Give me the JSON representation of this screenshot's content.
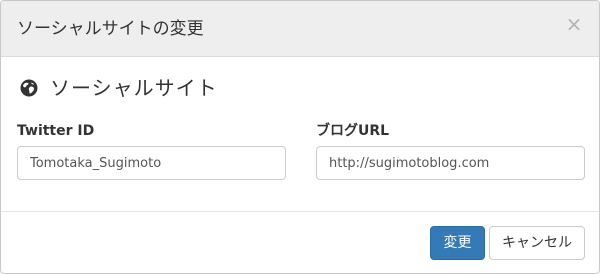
{
  "dialog": {
    "title": "ソーシャルサイトの変更",
    "close_symbol": "×"
  },
  "section": {
    "icon": "globe-icon",
    "title": "ソーシャルサイト"
  },
  "fields": {
    "twitter": {
      "label": "Twitter ID",
      "value": "Tomotaka_Sugimoto"
    },
    "blog": {
      "label": "ブログURL",
      "value": "http://sugimotoblog.com"
    }
  },
  "footer": {
    "save_label": "変更",
    "cancel_label": "キャンセル"
  },
  "colors": {
    "primary": "#337ab7",
    "header_bg": "#eeeeee"
  }
}
